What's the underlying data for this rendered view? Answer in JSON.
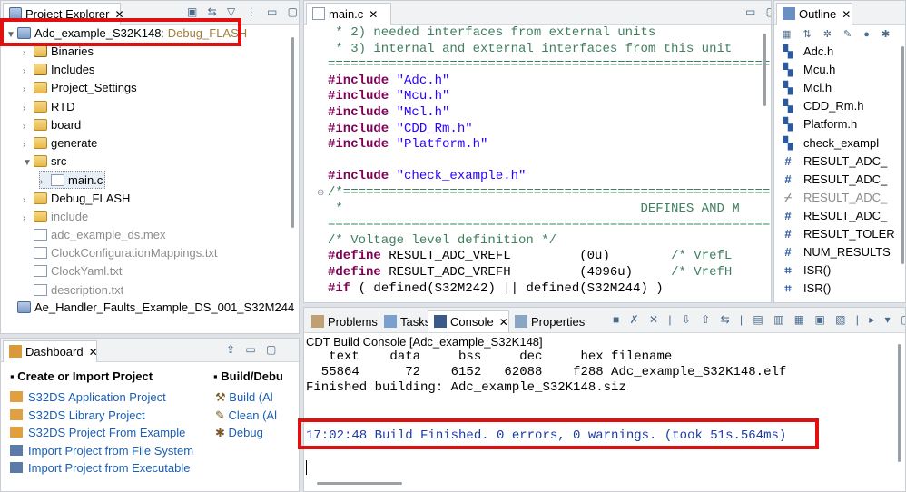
{
  "project_explorer": {
    "tab_label": "Project Explorer",
    "root": {
      "name": "Adc_example_S32K148",
      "decoration": ": Debug_FLASH"
    },
    "items": [
      {
        "label": "Binaries",
        "type": "bin",
        "expanded": false,
        "grey": false
      },
      {
        "label": "Includes",
        "type": "inc",
        "expanded": false,
        "grey": false
      },
      {
        "label": "Project_Settings",
        "type": "folder",
        "expanded": false,
        "grey": false
      },
      {
        "label": "RTD",
        "type": "folder",
        "expanded": false,
        "grey": false
      },
      {
        "label": "board",
        "type": "folder",
        "expanded": false,
        "grey": false
      },
      {
        "label": "generate",
        "type": "folder",
        "expanded": false,
        "grey": false
      },
      {
        "label": "src",
        "type": "folder",
        "expanded": true,
        "grey": false
      },
      {
        "label": "main.c",
        "type": "file",
        "expanded": false,
        "grey": false
      },
      {
        "label": "Debug_FLASH",
        "type": "folder",
        "expanded": false,
        "grey": false
      },
      {
        "label": "include",
        "type": "folder",
        "expanded": false,
        "grey": true
      },
      {
        "label": "adc_example_ds.mex",
        "type": "file",
        "expanded": false,
        "grey": true
      },
      {
        "label": "ClockConfigurationMappings.txt",
        "type": "file",
        "expanded": false,
        "grey": true
      },
      {
        "label": "ClockYaml.txt",
        "type": "file",
        "expanded": false,
        "grey": true
      },
      {
        "label": "description.txt",
        "type": "file",
        "expanded": false,
        "grey": true
      }
    ],
    "other_project": "Ae_Handler_Faults_Example_DS_001_S32M244"
  },
  "editor": {
    "tab_label": "main.c",
    "lines": [
      {
        "kind": "comment",
        "text": " * 2) needed interfaces from external units"
      },
      {
        "kind": "comment",
        "text": " * 3) internal and external interfaces from this unit"
      },
      {
        "kind": "comment",
        "text": "=========================================================="
      },
      {
        "kind": "include",
        "directive": "#include",
        "arg": " \"Adc.h\""
      },
      {
        "kind": "include",
        "directive": "#include",
        "arg": " \"Mcu.h\""
      },
      {
        "kind": "include",
        "directive": "#include",
        "arg": " \"Mcl.h\""
      },
      {
        "kind": "include",
        "directive": "#include",
        "arg": " \"CDD_Rm.h\""
      },
      {
        "kind": "include",
        "directive": "#include",
        "arg": " \"Platform.h\""
      },
      {
        "kind": "blank",
        "text": ""
      },
      {
        "kind": "include",
        "directive": "#include",
        "arg": " \"check_example.h\""
      },
      {
        "kind": "comment",
        "text": "/*========================================================="
      },
      {
        "kind": "comment",
        "text": " *                                       DEFINES AND M"
      },
      {
        "kind": "comment",
        "text": "=========================================================="
      },
      {
        "kind": "comment",
        "text": "/* Voltage level definition */"
      },
      {
        "kind": "define",
        "directive": "#define",
        "arg": " RESULT_ADC_VREFL         (0u)        ",
        "trail": "/* VrefL"
      },
      {
        "kind": "define",
        "directive": "#define",
        "arg": " RESULT_ADC_VREFH         (4096u)     ",
        "trail": "/* VrefH"
      },
      {
        "kind": "define",
        "directive": "#if",
        "arg": " ( defined(S32M242) || defined(S32M244) )",
        "trail": ""
      }
    ]
  },
  "outline": {
    "tab_label": "Outline",
    "items": [
      {
        "icon": "include-icon",
        "label": "Adc.h",
        "grey": false
      },
      {
        "icon": "include-icon",
        "label": "Mcu.h",
        "grey": false
      },
      {
        "icon": "include-icon",
        "label": "Mcl.h",
        "grey": false
      },
      {
        "icon": "include-icon",
        "label": "CDD_Rm.h",
        "grey": false
      },
      {
        "icon": "include-icon",
        "label": "Platform.h",
        "grey": false
      },
      {
        "icon": "include-icon",
        "label": "check_exampl",
        "grey": false
      },
      {
        "icon": "macro-icon",
        "label": "RESULT_ADC_",
        "grey": false
      },
      {
        "icon": "macro-icon",
        "label": "RESULT_ADC_",
        "grey": false
      },
      {
        "icon": "macro-disabled-icon",
        "label": "RESULT_ADC_",
        "grey": true
      },
      {
        "icon": "macro-icon",
        "label": "RESULT_ADC_",
        "grey": false
      },
      {
        "icon": "macro-icon",
        "label": "RESULT_TOLER",
        "grey": false
      },
      {
        "icon": "macro-icon",
        "label": "NUM_RESULTS",
        "grey": false
      },
      {
        "icon": "function-icon",
        "label": "ISR()",
        "grey": false
      },
      {
        "icon": "function-icon",
        "label": "ISR()",
        "grey": false
      }
    ]
  },
  "dashboard": {
    "tab_label": "Dashboard",
    "col1_header": "Create or Import Project",
    "col2_header": "Build/Debu",
    "col1_links": [
      "S32DS Application Project",
      "S32DS Library Project",
      "S32DS Project From Example",
      "Import Project from File System",
      "Import Project from Executable"
    ],
    "col2_links": [
      "Build  (Al",
      "Clean  (Al",
      "Debug"
    ]
  },
  "bottom": {
    "tabs": [
      "Problems",
      "Tasks",
      "Console",
      "Properties"
    ],
    "console_title": "CDT Build Console [Adc_example_S32K148]",
    "lines": [
      "   text    data     bss     dec     hex filename",
      "  55864      72    6152   62088    f288 Adc_example_S32K148.elf",
      "Finished building: Adc_example_S32K148.siz"
    ],
    "build_message": "17:02:48 Build Finished. 0 errors, 0 warnings. (took 51s.564ms)"
  },
  "colors": {
    "highlight_box": "#e01010",
    "link": "#1a5fb4",
    "comment": "#3f7f5f",
    "keyword": "#7f0055",
    "string": "#2a00ff"
  }
}
